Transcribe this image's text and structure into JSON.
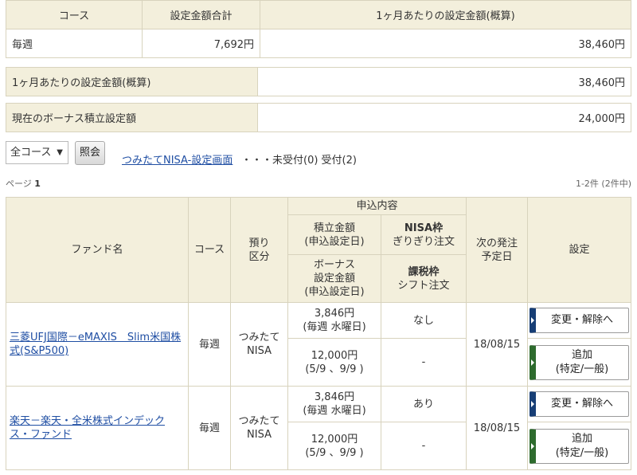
{
  "summary": {
    "headers": [
      "コース",
      "設定金額合計",
      "1ヶ月あたりの設定金額(概算)"
    ],
    "row": {
      "course": "毎週",
      "total": "7,692円",
      "monthly": "38,460円"
    }
  },
  "monthly_box": {
    "label": "1ヶ月あたりの設定金額(概算)",
    "value": "38,460円"
  },
  "bonus_box": {
    "label": "現在のボーナス積立設定額",
    "value": "24,000円"
  },
  "filter": {
    "selected": "全コース",
    "go_label": "照会",
    "link_text": "つみたてNISA-設定画面",
    "status": "・・・未受付(0) 受付(2)"
  },
  "paging": {
    "page_prefix": "ページ",
    "page_num": "1",
    "count": "1-2件 (2件中)"
  },
  "fund_table": {
    "h_fund": "ファンド名",
    "h_course": "コース",
    "h_account_1": "預り",
    "h_account_2": "区分",
    "h_apply": "申込内容",
    "h_amount_1": "積立金額",
    "h_amount_2": "(申込設定日)",
    "h_nisa_1": "NISA枠",
    "h_nisa_2": "ぎりぎり注文",
    "h_bonus_1": "ボーナス",
    "h_bonus_2": "設定金額",
    "h_bonus_3": "(申込設定日)",
    "h_tax_1": "課税枠",
    "h_tax_2": "シフト注文",
    "h_next_1": "次の発注",
    "h_next_2": "予定日",
    "h_setting": "設定",
    "rows": [
      {
        "fund": "三菱UFJ国際－eMAXIS　Slim米国株式(S&P500)",
        "course": "毎週",
        "account_1": "つみたて",
        "account_2": "NISA",
        "amount_1": "3,846円",
        "amount_2": "(毎週 水曜日)",
        "nisa": "なし",
        "bonus_1": "12,000円",
        "bonus_2": "(5/9 、9/9 )",
        "tax": "-",
        "next_date": "18/08/15",
        "change_btn": "変更・解除へ",
        "add_btn_1": "追加",
        "add_btn_2": "(特定/一般)"
      },
      {
        "fund": "楽天－楽天・全米株式インデックス・ファンド",
        "course": "毎週",
        "account_1": "つみたて",
        "account_2": "NISA",
        "amount_1": "3,846円",
        "amount_2": "(毎週 水曜日)",
        "nisa": "あり",
        "bonus_1": "12,000円",
        "bonus_2": "(5/9 、9/9 )",
        "tax": "-",
        "next_date": "18/08/15",
        "change_btn": "変更・解除へ",
        "add_btn_1": "追加",
        "add_btn_2": "(特定/一般)"
      }
    ]
  },
  "colors": {
    "header_bg": "#f3efdc",
    "border": "#d8d3bd",
    "link": "#1f4ea3",
    "button_blue": "#173e75",
    "button_green": "#2e6b2e"
  }
}
